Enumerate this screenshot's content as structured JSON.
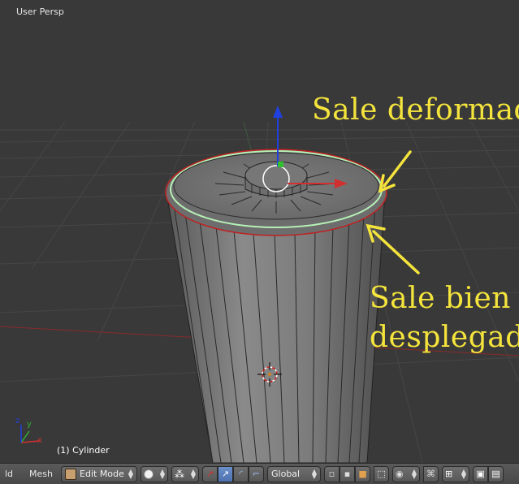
{
  "viewport": {
    "view_name": "User Persp",
    "object_name": "(1) Cylinder",
    "axis_labels": {
      "x": "x",
      "y": "y",
      "z": "z"
    },
    "annotations": {
      "top": "Sale deformada",
      "bottom_line1": "Sale bien",
      "bottom_line2": "desplegada"
    },
    "colors": {
      "background": "#393939",
      "grid": "#4a4a4a",
      "annotation": "#f4e43c",
      "x_axis": "#d23030",
      "y_axis": "#30b030",
      "z_axis": "#2040e0",
      "edge_selected": "#c02020",
      "seam": "#b6f0b6"
    }
  },
  "header": {
    "menu_partial": "ld",
    "menu_mesh": "Mesh",
    "mode_select": {
      "value": "Edit Mode",
      "icon": "edit-mode-icon"
    },
    "pivot_icon": "pivot-point-icon",
    "shading_icon": "shading-icon",
    "manipulator_icons": [
      "manipulator-toggle-icon",
      "translate-icon",
      "rotate-icon",
      "scale-icon"
    ],
    "orientation_select": {
      "value": "Global"
    },
    "select_mode_icons": [
      "vertex-select-icon",
      "edge-select-icon",
      "face-select-icon"
    ],
    "occlude_icon": "occlude-geometry-icon",
    "proportional_icon": "proportional-edit-icon",
    "snap_icons": [
      "snap-toggle-icon",
      "snap-element-icon"
    ],
    "render_icons": [
      "opengl-render-icon",
      "opengl-animation-icon"
    ]
  }
}
